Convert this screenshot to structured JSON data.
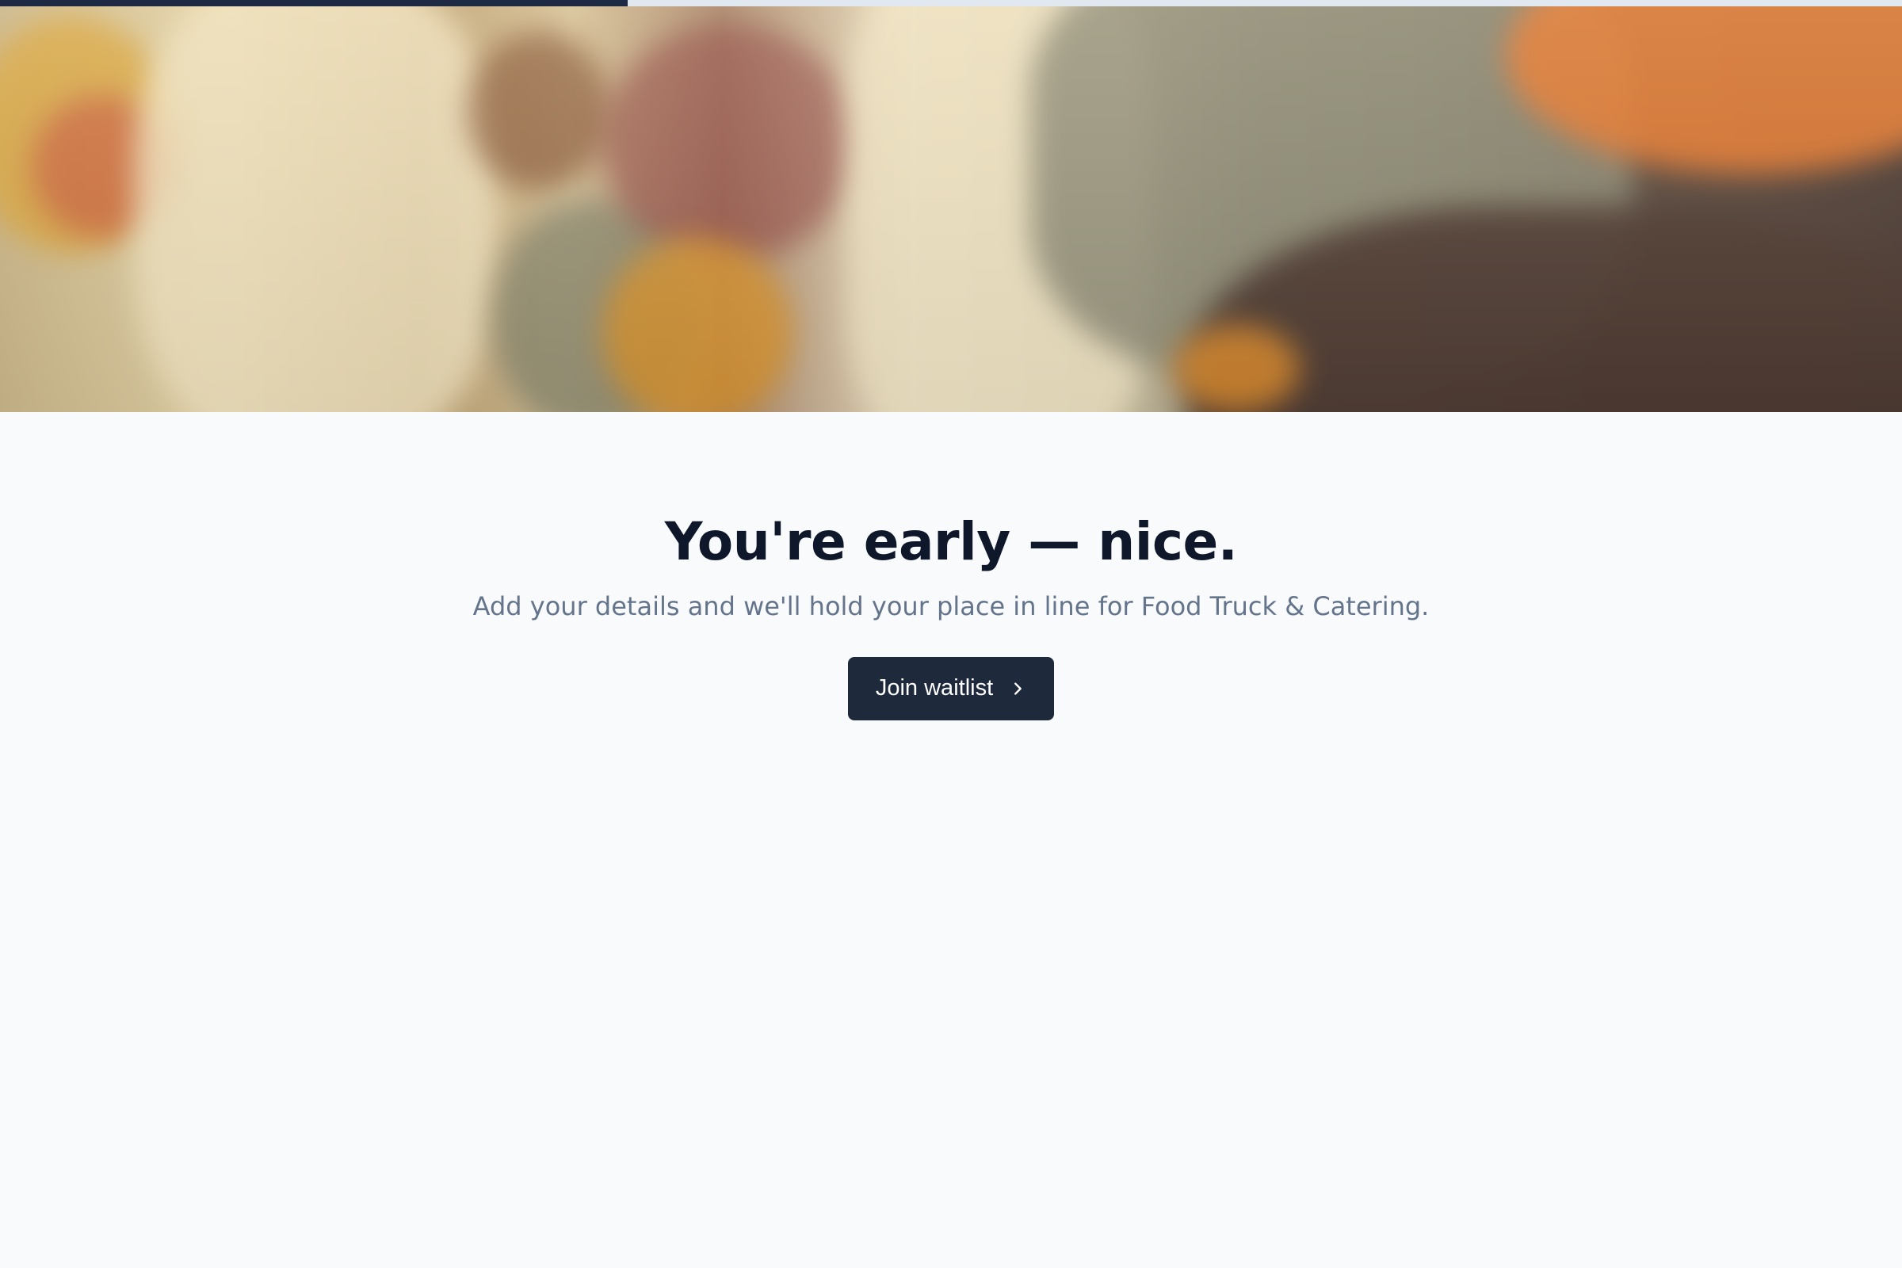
{
  "progress": {
    "value_percent": 33
  },
  "hero": {
    "image": "food-market-vendor-photo"
  },
  "main": {
    "headline": "You're early — nice.",
    "subtext": "Add your details and we'll hold your place in line for Food Truck & Catering.",
    "cta_label": "Join waitlist",
    "cta_icon": "chevron-right-icon"
  },
  "colors": {
    "background": "#f8fafc",
    "headline": "#0f172a",
    "subtext": "#64748b",
    "button": "#1e293b",
    "progress_fill": "#1e2a44",
    "progress_track": "#e2e8f0"
  }
}
